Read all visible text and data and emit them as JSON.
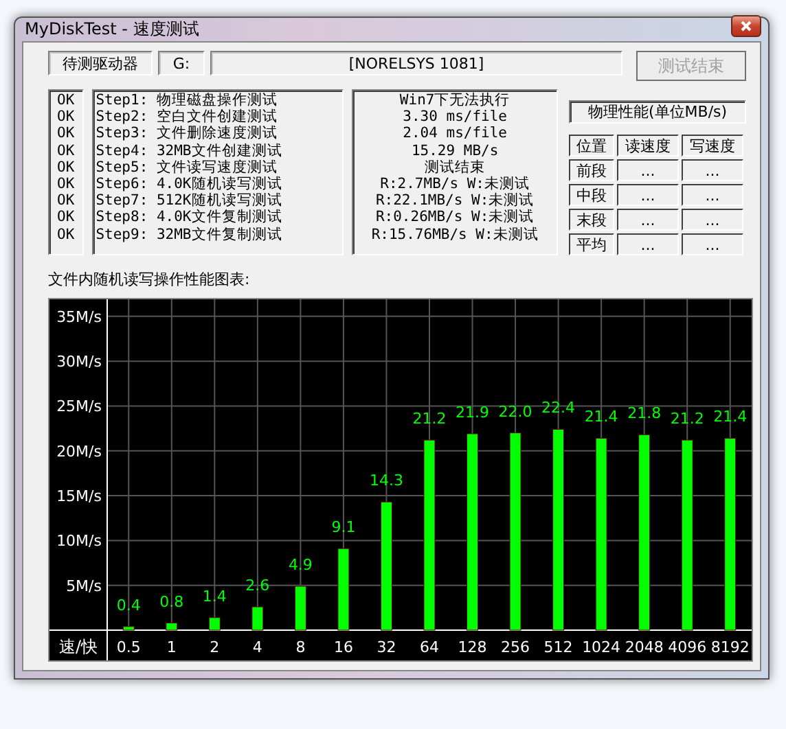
{
  "window": {
    "title": "MyDiskTest - 速度测试"
  },
  "drive": {
    "label": "待测驱动器",
    "letter": "G:",
    "name": "[NORELSYS 1081]"
  },
  "stop_button": {
    "label": "测试结束",
    "disabled": true
  },
  "tests": [
    {
      "status": "OK",
      "name": "Step1: 物理磁盘操作测试",
      "result": "Win7下无法执行"
    },
    {
      "status": "OK",
      "name": "Step2: 空白文件创建测试",
      "result": "3.30 ms/file"
    },
    {
      "status": "OK",
      "name": "Step3: 文件删除速度测试",
      "result": "2.04 ms/file"
    },
    {
      "status": "OK",
      "name": "Step4: 32MB文件创建测试",
      "result": "15.29 MB/s"
    },
    {
      "status": "OK",
      "name": "Step5: 文件读写速度测试",
      "result": "测试结束"
    },
    {
      "status": "OK",
      "name": "Step6: 4.0K随机读写测试",
      "result": "R:2.7MB/s W:未测试"
    },
    {
      "status": "OK",
      "name": "Step7: 512K随机读写测试",
      "result": "R:22.1MB/s W:未测试"
    },
    {
      "status": "OK",
      "name": "Step8: 4.0K文件复制测试",
      "result": "R:0.26MB/s W:未测试"
    },
    {
      "status": "OK",
      "name": "Step9: 32MB文件复制测试",
      "result": "R:15.76MB/s W:未测试"
    }
  ],
  "physical": {
    "title": "物理性能(单位MB/s)",
    "columns": [
      "位置",
      "读速度",
      "写速度"
    ],
    "rows": [
      {
        "position": "前段",
        "read": "...",
        "write": "..."
      },
      {
        "position": "中段",
        "read": "...",
        "write": "..."
      },
      {
        "position": "末段",
        "read": "...",
        "write": "..."
      },
      {
        "position": "平均",
        "read": "...",
        "write": "..."
      }
    ]
  },
  "chart": {
    "title": "文件内随机读写操作性能图表:",
    "chart_data": {
      "type": "bar",
      "xlabel": "速/快",
      "categories": [
        "0.5",
        "1",
        "2",
        "4",
        "8",
        "16",
        "32",
        "64",
        "128",
        "256",
        "512",
        "1024",
        "2048",
        "4096",
        "8192"
      ],
      "grid": true,
      "series": [
        {
          "color": "#00ff00",
          "values": [
            0.4,
            0.8,
            1.4,
            2.6,
            4.9,
            9.1,
            14.3,
            21.2,
            21.9,
            22.0,
            22.4,
            21.4,
            21.8,
            21.2,
            21.4
          ]
        }
      ],
      "value_labels": [
        "0.4",
        "0.8",
        "1.4",
        "2.6",
        "4.9",
        "9.1",
        "14.3",
        "21.2",
        "21.9",
        "22.0",
        "22.4",
        "21.4",
        "21.8",
        "21.2",
        "21.4"
      ],
      "ylim": [
        0,
        36.9
      ],
      "yticks": [
        {
          "value": 5,
          "label": "5M/s"
        },
        {
          "value": 10,
          "label": "10M/s"
        },
        {
          "value": 15,
          "label": "15M/s"
        },
        {
          "value": 20,
          "label": "20M/s"
        },
        {
          "value": 25,
          "label": "25M/s"
        },
        {
          "value": 30,
          "label": "30M/s"
        },
        {
          "value": 35,
          "label": "35M/s"
        }
      ]
    }
  }
}
